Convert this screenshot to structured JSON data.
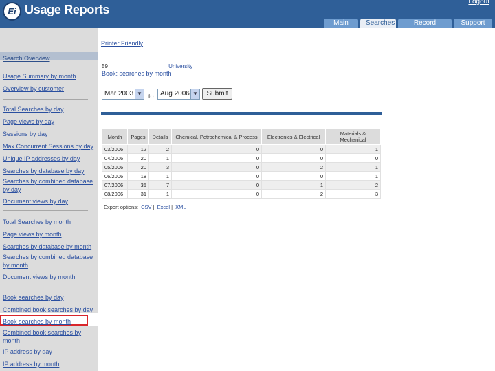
{
  "header": {
    "logo_text": "Ei",
    "title": "Usage Reports",
    "logout": "Logout",
    "tabs": [
      "Main",
      "Searches",
      "Record Description",
      "Support"
    ]
  },
  "sidebar": {
    "heading": "Search Overview",
    "group1": [
      "Usage Summary by month",
      "Overview by customer"
    ],
    "group2": [
      "Total Searches by day",
      "Page views by day",
      "Sessions by day",
      "Max Concurrent Sessions by day",
      "Unique IP addresses by day",
      "Searches by database by day",
      "Searches by combined database by day",
      "Document views by day"
    ],
    "group3": [
      "Total Searches by month",
      "Page views by month",
      "Searches by database by month",
      "Searches by combined database by month",
      "Document views by month"
    ],
    "group4": [
      "Book searches by day",
      "Combined book searches by day",
      "Book searches by month",
      "Combined book searches by month",
      "IP address by day",
      "IP address by month"
    ]
  },
  "main": {
    "printer_friendly": "Printer Friendly",
    "account_id": "59",
    "institution": "University",
    "report_title": "Book: searches by month",
    "from_month": "Mar 2003",
    "to_label": "to",
    "to_month": "Aug 2006",
    "submit": "Submit"
  },
  "table": {
    "headers": [
      "Month",
      "Pages",
      "Details",
      "Chemical, Petrochemical & Process",
      "Electronics & Electrical",
      "Materials & Mechanical"
    ],
    "rows": [
      [
        "03/2006",
        "12",
        "2",
        "0",
        "0",
        "1"
      ],
      [
        "04/2006",
        "20",
        "1",
        "0",
        "0",
        "0"
      ],
      [
        "05/2006",
        "20",
        "3",
        "0",
        "2",
        "1"
      ],
      [
        "06/2006",
        "18",
        "1",
        "0",
        "0",
        "1"
      ],
      [
        "07/2006",
        "35",
        "7",
        "0",
        "1",
        "2"
      ],
      [
        "08/2006",
        "31",
        "1",
        "0",
        "2",
        "3"
      ]
    ],
    "export_label": "Export options:",
    "export_links": [
      "CSV",
      "Excel",
      "XML"
    ]
  }
}
